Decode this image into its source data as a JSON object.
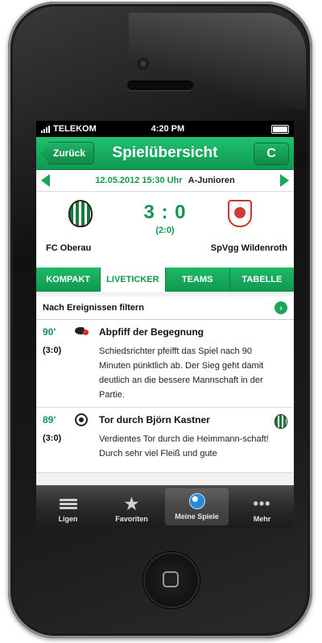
{
  "status_bar": {
    "carrier": "TELEKOM",
    "time": "4:20 PM"
  },
  "navbar": {
    "back_label": "Zurück",
    "title": "Spielübersicht",
    "refresh_glyph": "C"
  },
  "match": {
    "date_time": "12.05.2012 15:30 Uhr",
    "league": "A-Junioren",
    "home_team": "FC Oberau",
    "away_team": "SpVgg Wildenroth",
    "score": "3 : 0",
    "halftime": "(2:0)"
  },
  "tabs": [
    {
      "label": "KOMPAKT"
    },
    {
      "label": "LIVETICKER",
      "active": true
    },
    {
      "label": "TEAMS"
    },
    {
      "label": "TABELLE"
    }
  ],
  "filter": {
    "label": "Nach Ereignissen filtern"
  },
  "events": [
    {
      "minute": "90'",
      "score": "(3:0)",
      "icon": "whistle-icon",
      "title": "Abpfiff der Begegnung",
      "text": "Schiedsrichter pfeifft das Spiel nach 90 Minuten pünktlich ab. Der Sieg geht damit deutlich an die bessere Mannschaft in der Partie."
    },
    {
      "minute": "89'",
      "score": "(3:0)",
      "icon": "ball-icon",
      "title": "Tor durch Björn Kastner",
      "text": "Verdientes Tor durch die Heimmann-schaft! Durch sehr viel Fleiß und gute"
    }
  ],
  "tab_bar": [
    {
      "label": "Ligen",
      "icon": "list-icon"
    },
    {
      "label": "Favoriten",
      "icon": "star-icon"
    },
    {
      "label": "Meine Spiele",
      "icon": "soccer-ball-icon",
      "active": true
    },
    {
      "label": "Mehr",
      "icon": "more-dots-icon"
    }
  ],
  "colors": {
    "primary_green": "#14964f",
    "nav_green": "#1fb968",
    "tabbar_dark": "#2a2a2a"
  }
}
